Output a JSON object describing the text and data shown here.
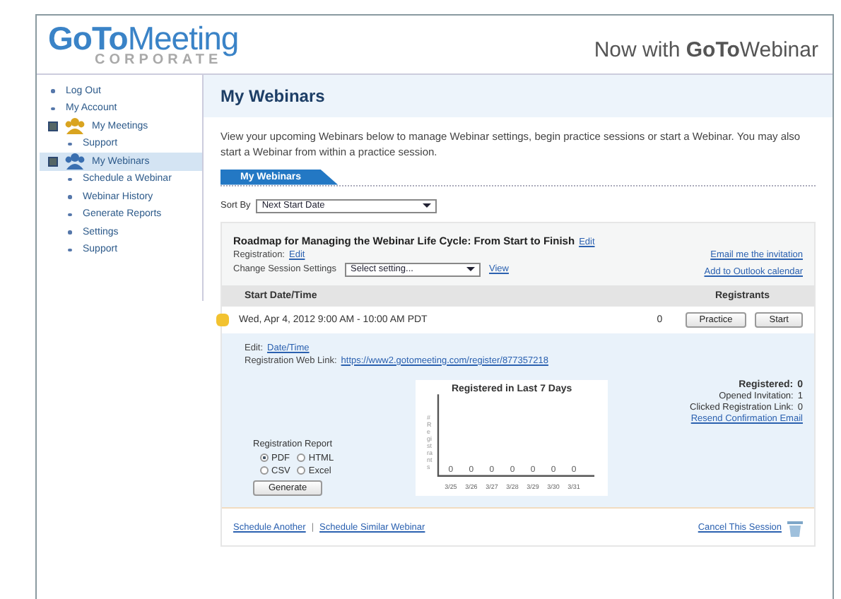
{
  "header": {
    "logo": "**GoTo**Meeting",
    "logo_sub": "CORPORATE",
    "tagline": "Now with **GoTo**Webinar"
  },
  "sidebar": {
    "items": [
      {
        "label": "Log Out",
        "kind": "link",
        "selected": false
      },
      {
        "label": "My Account",
        "kind": "link",
        "selected": false
      },
      {
        "label": "My Meetings",
        "kind": "group",
        "selected": false,
        "expanded": true,
        "children": [
          {
            "label": "Support",
            "kind": "link",
            "selected": false
          }
        ]
      },
      {
        "label": "My Webinars",
        "kind": "group",
        "selected": true,
        "expanded": true,
        "children": [
          {
            "label": "Schedule a Webinar",
            "kind": "link",
            "selected": false
          },
          {
            "label": "Webinar History",
            "kind": "link",
            "selected": false
          },
          {
            "label": "Generate Reports",
            "kind": "link",
            "selected": false
          },
          {
            "label": "Settings",
            "kind": "link",
            "selected": false
          },
          {
            "label": "Support",
            "kind": "link",
            "selected": false
          }
        ]
      }
    ]
  },
  "page": {
    "title": "My Webinars",
    "intro": "View your upcoming Webinars below to manage Webinar settings, begin practice sessions or start a Webinar. You may also start a Webinar from within a practice session.",
    "tabs": [
      {
        "label": "My Webinars",
        "selected": true
      }
    ],
    "sort": {
      "label": "Sort By",
      "value": "Next Start Date"
    }
  },
  "webinar": {
    "title": "Roadmap for Managing the Webinar Life Cycle: From Start to Finish",
    "title_edit": "Edit",
    "registration_label": "Registration:",
    "registration_edit": "Edit",
    "session_label": "Change Session Settings",
    "session_value": "Select setting...",
    "view": "View",
    "email_link": "Email me the invitation",
    "outlook_link": "Add to Outlook calendar",
    "columns": [
      "Start Date/Time",
      "Registrants"
    ],
    "session": {
      "time": "Wed, Apr 4, 2012 9:00 AM - 10:00 AM PDT",
      "registrants": "0",
      "buttons": [
        "Practice",
        "Start"
      ]
    },
    "edit_label": "Edit:",
    "edit_link": "Date/Time",
    "web_link_label": "Registration Web Link:",
    "web_link": "https://www2.gotomeeting.com/register/877357218",
    "report": {
      "title": "Registration Report",
      "formats": [
        {
          "label": "PDF",
          "selected": true
        },
        {
          "label": "HTML",
          "selected": false
        },
        {
          "label": "CSV",
          "selected": false
        },
        {
          "label": "Excel",
          "selected": false
        }
      ],
      "button": "Generate"
    },
    "chart": {
      "title": "Registered in Last 7 Days",
      "ylabel": "# Registrants",
      "x_labels": [
        "3/25",
        "3/26",
        "3/27",
        "3/28",
        "3/29",
        "3/30",
        "3/31"
      ],
      "point_labels": [
        "0",
        "0",
        "0",
        "0",
        "0",
        "0",
        "0"
      ]
    },
    "stats": [
      {
        "label": "Registered:",
        "value": "0",
        "kind": "total"
      },
      {
        "label": "Opened Invitation:",
        "value": "1",
        "kind": "plain"
      },
      {
        "label": "Clicked Registration Link:",
        "value": "0",
        "kind": "plain"
      }
    ],
    "resend": "Resend Confirmation Email",
    "footer_links": [
      "Schedule Another",
      "Schedule Similar Webinar"
    ],
    "footer_separator": "|",
    "cancel": "Cancel This Session"
  }
}
